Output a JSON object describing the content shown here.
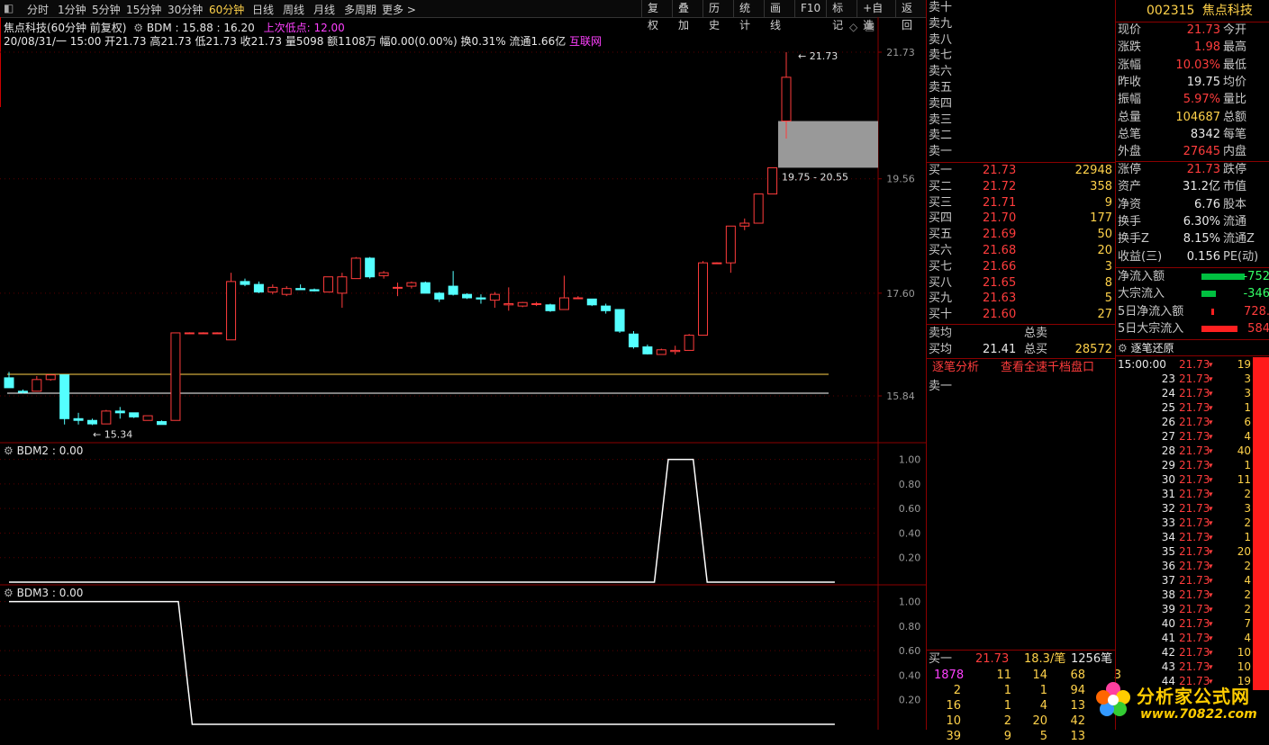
{
  "toolbar": {
    "periods": [
      "分时",
      "1分钟",
      "5分钟",
      "15分钟",
      "30分钟",
      "60分钟",
      "日线",
      "周线",
      "月线",
      "多周期",
      "更多 >"
    ],
    "selected": "60分钟",
    "buttons": [
      "复权",
      "叠加",
      "历史",
      "统计",
      "画线",
      "F10",
      "标记",
      "+自选",
      "返回"
    ]
  },
  "header": {
    "stock_title": "焦点科技(60分钟 前复权)",
    "indicator": "BDM : 15.88 : 16.20",
    "last_low": "上次低点: 12.00",
    "info_line": "20/08/31/一 15:00 开21.73 高21.73 低21.73 收21.73 量5098 额1108万 幅0.00(0.00%) 换0.31% 流通1.66亿",
    "sector": "互联网"
  },
  "chart_data": [
    {
      "type": "candlestick",
      "ylim": [
        15.0,
        22.4
      ],
      "yticks": [
        "21.73",
        "19.56",
        "17.60",
        "15.84"
      ],
      "annotations": {
        "high_label": "21.73",
        "low_label": "15.34",
        "range_box": "19.75 - 20.55"
      },
      "reference_lines": [
        15.95,
        15.65
      ],
      "candles": [
        {
          "o": 16.15,
          "h": 16.25,
          "l": 15.98,
          "c": 15.98
        },
        {
          "o": 15.92,
          "h": 15.95,
          "l": 15.88,
          "c": 15.9
        },
        {
          "o": 15.92,
          "h": 16.18,
          "l": 15.92,
          "c": 16.12
        },
        {
          "o": 16.12,
          "h": 16.2,
          "l": 16.1,
          "c": 16.2
        },
        {
          "o": 16.2,
          "h": 16.2,
          "l": 15.35,
          "c": 15.45
        },
        {
          "o": 15.45,
          "h": 15.55,
          "l": 15.35,
          "c": 15.42
        },
        {
          "o": 15.42,
          "h": 15.45,
          "l": 15.34,
          "c": 15.36
        },
        {
          "o": 15.36,
          "h": 15.6,
          "l": 15.36,
          "c": 15.58
        },
        {
          "o": 15.58,
          "h": 15.65,
          "l": 15.45,
          "c": 15.55
        },
        {
          "o": 15.55,
          "h": 15.55,
          "l": 15.46,
          "c": 15.48
        },
        {
          "o": 15.42,
          "h": 15.5,
          "l": 15.42,
          "c": 15.5
        },
        {
          "o": 15.4,
          "h": 15.42,
          "l": 15.35,
          "c": 15.35
        },
        {
          "o": 15.42,
          "h": 16.92,
          "l": 15.42,
          "c": 16.92
        },
        {
          "o": 16.92,
          "h": 16.93,
          "l": 16.91,
          "c": 16.92
        },
        {
          "o": 16.92,
          "h": 16.93,
          "l": 16.91,
          "c": 16.92
        },
        {
          "o": 16.92,
          "h": 16.93,
          "l": 16.91,
          "c": 16.92
        },
        {
          "o": 16.8,
          "h": 17.95,
          "l": 16.8,
          "c": 17.8
        },
        {
          "o": 17.8,
          "h": 17.85,
          "l": 17.72,
          "c": 17.75
        },
        {
          "o": 17.75,
          "h": 17.8,
          "l": 17.6,
          "c": 17.62
        },
        {
          "o": 17.62,
          "h": 17.75,
          "l": 17.58,
          "c": 17.7
        },
        {
          "o": 17.58,
          "h": 17.72,
          "l": 17.55,
          "c": 17.68
        },
        {
          "o": 17.68,
          "h": 17.75,
          "l": 17.66,
          "c": 17.66
        },
        {
          "o": 17.66,
          "h": 17.68,
          "l": 17.63,
          "c": 17.64
        },
        {
          "o": 17.62,
          "h": 17.88,
          "l": 17.62,
          "c": 17.88
        },
        {
          "o": 17.6,
          "h": 17.95,
          "l": 17.35,
          "c": 17.88
        },
        {
          "o": 17.85,
          "h": 18.22,
          "l": 17.85,
          "c": 18.2
        },
        {
          "o": 18.2,
          "h": 18.22,
          "l": 17.85,
          "c": 17.88
        },
        {
          "o": 17.9,
          "h": 17.98,
          "l": 17.85,
          "c": 17.95
        },
        {
          "o": 17.7,
          "h": 17.78,
          "l": 17.55,
          "c": 17.7
        },
        {
          "o": 17.72,
          "h": 17.8,
          "l": 17.68,
          "c": 17.78
        },
        {
          "o": 17.78,
          "h": 17.8,
          "l": 17.6,
          "c": 17.6
        },
        {
          "o": 17.6,
          "h": 17.62,
          "l": 17.45,
          "c": 17.5
        },
        {
          "o": 17.72,
          "h": 17.98,
          "l": 17.56,
          "c": 17.58
        },
        {
          "o": 17.58,
          "h": 17.6,
          "l": 17.5,
          "c": 17.52
        },
        {
          "o": 17.52,
          "h": 17.58,
          "l": 17.42,
          "c": 17.5
        },
        {
          "o": 17.48,
          "h": 17.62,
          "l": 17.35,
          "c": 17.58
        },
        {
          "o": 17.4,
          "h": 17.7,
          "l": 17.3,
          "c": 17.42
        },
        {
          "o": 17.38,
          "h": 17.45,
          "l": 17.36,
          "c": 17.44
        },
        {
          "o": 17.42,
          "h": 17.45,
          "l": 17.38,
          "c": 17.42
        },
        {
          "o": 17.4,
          "h": 17.42,
          "l": 17.28,
          "c": 17.3
        },
        {
          "o": 17.32,
          "h": 17.9,
          "l": 17.32,
          "c": 17.52
        },
        {
          "o": 17.52,
          "h": 17.55,
          "l": 17.5,
          "c": 17.52
        },
        {
          "o": 17.5,
          "h": 17.5,
          "l": 17.38,
          "c": 17.4
        },
        {
          "o": 17.38,
          "h": 17.42,
          "l": 17.25,
          "c": 17.3
        },
        {
          "o": 17.32,
          "h": 17.32,
          "l": 16.92,
          "c": 16.95
        },
        {
          "o": 16.9,
          "h": 16.95,
          "l": 16.65,
          "c": 16.68
        },
        {
          "o": 16.68,
          "h": 16.72,
          "l": 16.55,
          "c": 16.56
        },
        {
          "o": 16.55,
          "h": 16.65,
          "l": 16.55,
          "c": 16.63
        },
        {
          "o": 16.6,
          "h": 16.7,
          "l": 16.55,
          "c": 16.62
        },
        {
          "o": 16.62,
          "h": 16.9,
          "l": 16.62,
          "c": 16.88
        },
        {
          "o": 16.88,
          "h": 18.15,
          "l": 16.88,
          "c": 18.12
        },
        {
          "o": 18.12,
          "h": 18.13,
          "l": 18.11,
          "c": 18.12
        },
        {
          "o": 18.12,
          "h": 18.75,
          "l": 17.95,
          "c": 18.75
        },
        {
          "o": 18.75,
          "h": 18.88,
          "l": 18.68,
          "c": 18.8
        },
        {
          "o": 18.8,
          "h": 19.3,
          "l": 18.8,
          "c": 19.3
        },
        {
          "o": 19.3,
          "h": 19.75,
          "l": 19.3,
          "c": 19.75
        },
        {
          "o": 20.55,
          "h": 21.73,
          "l": 20.25,
          "c": 21.3
        }
      ]
    },
    {
      "type": "line",
      "title": "BDM2 : 0.00",
      "ylim": [
        0,
        1.1
      ],
      "yticks": [
        "1.00",
        "0.80",
        "0.60",
        "0.40",
        "0.20"
      ],
      "x": [
        0,
        46.5,
        47.5,
        49.3,
        50.3,
        59.5
      ],
      "values": [
        0,
        0,
        1,
        1,
        0,
        0
      ]
    },
    {
      "type": "line",
      "title": "BDM3 : 0.00",
      "ylim": [
        0,
        1.1
      ],
      "yticks": [
        "1.00",
        "0.80",
        "0.60",
        "0.40",
        "0.20"
      ],
      "x": [
        0,
        12.2,
        13.2,
        59.5
      ],
      "values": [
        1,
        1,
        0,
        0
      ]
    }
  ],
  "orderbook": {
    "sell": [
      {
        "label": "卖十"
      },
      {
        "label": "卖九"
      },
      {
        "label": "卖八"
      },
      {
        "label": "卖七"
      },
      {
        "label": "卖六"
      },
      {
        "label": "卖五"
      },
      {
        "label": "卖四"
      },
      {
        "label": "卖三"
      },
      {
        "label": "卖二"
      },
      {
        "label": "卖一"
      }
    ],
    "buy": [
      {
        "label": "买一",
        "price": "21.73",
        "vol": "22948"
      },
      {
        "label": "买二",
        "price": "21.72",
        "vol": "358"
      },
      {
        "label": "买三",
        "price": "21.71",
        "vol": "9"
      },
      {
        "label": "买四",
        "price": "21.70",
        "vol": "177"
      },
      {
        "label": "买五",
        "price": "21.69",
        "vol": "50"
      },
      {
        "label": "买六",
        "price": "21.68",
        "vol": "20"
      },
      {
        "label": "买七",
        "price": "21.66",
        "vol": "3"
      },
      {
        "label": "买八",
        "price": "21.65",
        "vol": "8"
      },
      {
        "label": "买九",
        "price": "21.63",
        "vol": "5"
      },
      {
        "label": "买十",
        "price": "21.60",
        "vol": "27"
      }
    ],
    "avg_sell_label": "卖均",
    "total_sell_label": "总卖",
    "avg_buy_label": "买均",
    "avg_buy": "21.41",
    "total_buy_label": "总买",
    "total_buy": "28572",
    "tabs": [
      "逐笔分析",
      "查看全速千档盘口"
    ],
    "sell1": "卖一",
    "bottom_buy": {
      "label": "买一",
      "price": "21.73",
      "avg": "18.3/笔",
      "count": "1256笔"
    },
    "bottom_rows": [
      [
        "1878",
        "11",
        "14",
        "68",
        "3"
      ],
      [
        "2",
        "1",
        "1",
        "94",
        "1"
      ],
      [
        "16",
        "1",
        "4",
        "13",
        ""
      ],
      [
        "10",
        "2",
        "20",
        "42",
        ""
      ],
      [
        "39",
        "9",
        "5",
        "13",
        ""
      ]
    ]
  },
  "quote": {
    "code": "002315",
    "name": "焦点科技",
    "rows": [
      [
        "现价",
        "21.73",
        "今开",
        ""
      ],
      [
        "涨跌",
        "1.98",
        "最高",
        ""
      ],
      [
        "涨幅",
        "10.03%",
        "最低",
        ""
      ],
      [
        "昨收",
        "19.75",
        "均价",
        ""
      ],
      [
        "振幅",
        "5.97%",
        "量比",
        ""
      ],
      [
        "总量",
        "104687",
        "总额",
        ""
      ],
      [
        "总笔",
        "8342",
        "每笔",
        ""
      ],
      [
        "外盘",
        "27645",
        "内盘",
        ""
      ]
    ],
    "rows2": [
      [
        "涨停",
        "21.73",
        "跌停",
        ""
      ],
      [
        "资产",
        "31.2亿",
        "市值",
        ""
      ],
      [
        "净资",
        "6.76",
        "股本",
        ""
      ],
      [
        "换手",
        "6.30%",
        "流通",
        ""
      ],
      [
        "换手Z",
        "8.15%",
        "流通Z",
        ""
      ],
      [
        "收益(三)",
        "0.156",
        "PE(动)",
        ""
      ]
    ],
    "flows": [
      {
        "label": "净流入额",
        "value": "-752",
        "color": "#00c040"
      },
      {
        "label": "大宗流入",
        "value": "-346",
        "color": "#00c040"
      },
      {
        "label": "5日净流入额",
        "value": "728.",
        "color": "#ff2020"
      },
      {
        "label": "5日大宗流入",
        "value": "584",
        "color": "#ff2020"
      }
    ]
  },
  "ticks": {
    "title": "逐笔还原",
    "rows": [
      [
        "15:00:00",
        "21.73",
        "19"
      ],
      [
        "23",
        "21.73",
        "3"
      ],
      [
        "24",
        "21.73",
        "3"
      ],
      [
        "25",
        "21.73",
        "1"
      ],
      [
        "26",
        "21.73",
        "6"
      ],
      [
        "27",
        "21.73",
        "4"
      ],
      [
        "28",
        "21.73",
        "40"
      ],
      [
        "29",
        "21.73",
        "1"
      ],
      [
        "30",
        "21.73",
        "11"
      ],
      [
        "31",
        "21.73",
        "2"
      ],
      [
        "32",
        "21.73",
        "3"
      ],
      [
        "33",
        "21.73",
        "2"
      ],
      [
        "34",
        "21.73",
        "1"
      ],
      [
        "35",
        "21.73",
        "20"
      ],
      [
        "36",
        "21.73",
        "2"
      ],
      [
        "37",
        "21.73",
        "4"
      ],
      [
        "38",
        "21.73",
        "2"
      ],
      [
        "39",
        "21.73",
        "2"
      ],
      [
        "40",
        "21.73",
        "7"
      ],
      [
        "41",
        "21.73",
        "4"
      ],
      [
        "42",
        "21.73",
        "10"
      ],
      [
        "43",
        "21.73",
        "10"
      ],
      [
        "44",
        "21.73",
        "19"
      ]
    ]
  },
  "watermark": {
    "text": "分析家公式网",
    "url": "www.70822.com"
  }
}
